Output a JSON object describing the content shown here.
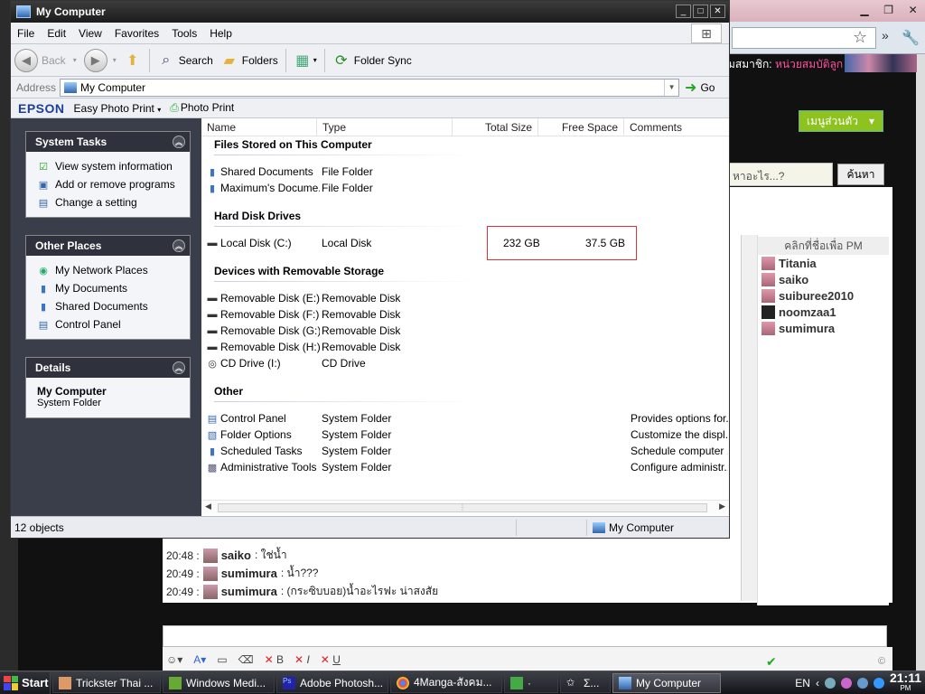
{
  "window": {
    "title": "My Computer"
  },
  "menubar": [
    "File",
    "Edit",
    "View",
    "Favorites",
    "Tools",
    "Help"
  ],
  "toolbar": {
    "back": "Back",
    "search": "Search",
    "folders": "Folders",
    "folder_sync": "Folder Sync"
  },
  "address": {
    "label": "Address",
    "value": "My Computer",
    "go": "Go"
  },
  "epson_bar": {
    "brand": "EPSON",
    "easy_photo_print": "Easy Photo Print",
    "photo_print": "Photo Print"
  },
  "left_pane": {
    "system_tasks": {
      "title": "System Tasks",
      "items": [
        "View system information",
        "Add or remove programs",
        "Change a setting"
      ]
    },
    "other_places": {
      "title": "Other Places",
      "items": [
        "My Network Places",
        "My Documents",
        "Shared Documents",
        "Control Panel"
      ]
    },
    "details": {
      "title": "Details",
      "name": "My Computer",
      "type": "System Folder"
    }
  },
  "columns": [
    "Name",
    "Type",
    "Total Size",
    "Free Space",
    "Comments"
  ],
  "groups": {
    "files_stored": {
      "title": "Files Stored on This Computer",
      "rows": [
        {
          "name": "Shared Documents",
          "type": "File Folder"
        },
        {
          "name": "Maximum's Docume...",
          "type": "File Folder"
        }
      ]
    },
    "hard_disks": {
      "title": "Hard Disk Drives",
      "rows": [
        {
          "name": "Local Disk (C:)",
          "type": "Local Disk",
          "total": "232 GB",
          "free": "37.5 GB"
        }
      ]
    },
    "removable": {
      "title": "Devices with Removable Storage",
      "rows": [
        {
          "name": "Removable Disk (E:)",
          "type": "Removable Disk"
        },
        {
          "name": "Removable Disk (F:)",
          "type": "Removable Disk"
        },
        {
          "name": "Removable Disk (G:)",
          "type": "Removable Disk"
        },
        {
          "name": "Removable Disk (H:)",
          "type": "Removable Disk"
        },
        {
          "name": "CD Drive (I:)",
          "type": "CD Drive"
        }
      ]
    },
    "other": {
      "title": "Other",
      "rows": [
        {
          "name": "Control Panel",
          "type": "System Folder",
          "comment": "Provides options for..."
        },
        {
          "name": "Folder Options",
          "type": "System Folder",
          "comment": "Customize the displ..."
        },
        {
          "name": "Scheduled Tasks",
          "type": "System Folder",
          "comment": "Schedule computer ..."
        },
        {
          "name": "Administrative Tools",
          "type": "System Folder",
          "comment": "Configure administr..."
        }
      ]
    }
  },
  "status": {
    "count": "12 objects",
    "location": "My Computer"
  },
  "background_page": {
    "member_text": "มสมาชิก:",
    "member_link": "หน่วยสมบัติลูก",
    "menu_button": "เมนูส่วนตัว",
    "search_placeholder": "หาอะไร...?",
    "search_button": "ค้นหา",
    "pm_title": "คลิกที่ชื่อเพื่อ PM",
    "pm_users": [
      "Titania",
      "saiko",
      "suiburee2010",
      "noomzaa1",
      "sumimura"
    ],
    "chat": [
      {
        "time": "20:48 :",
        "user": "saiko",
        "msg": ": ใช่น้ำ"
      },
      {
        "time": "20:49 :",
        "user": "sumimura",
        "msg": ": น้ำ???"
      },
      {
        "time": "20:49 :",
        "user": "sumimura",
        "msg": ": (กระซิบบอย)น้ำอะไรฟะ น่าสงสัย"
      }
    ],
    "copyright": "©"
  },
  "taskbar": {
    "start": "Start",
    "tasks": [
      "Trickster Thai ...",
      "Windows Medi...",
      "Adobe Photosh...",
      "4Manga-สังคม...",
      "·",
      "Σ...",
      "My Computer"
    ],
    "lang": "EN",
    "time": "21:11",
    "ampm": "PM"
  }
}
